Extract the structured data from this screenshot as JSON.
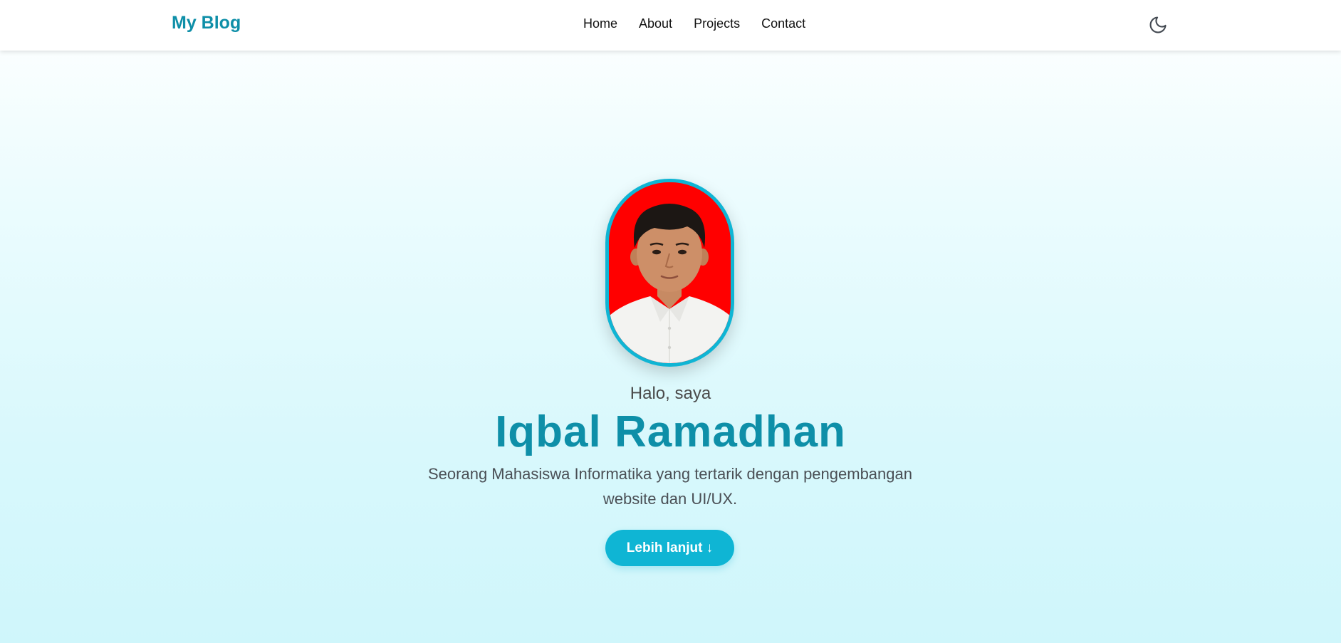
{
  "navbar": {
    "brand": "My Blog",
    "links": [
      {
        "label": "Home"
      },
      {
        "label": "About"
      },
      {
        "label": "Projects"
      },
      {
        "label": "Contact"
      }
    ],
    "theme_toggle_icon": "moon-icon"
  },
  "hero": {
    "greeting": "Halo, saya",
    "name": "Iqbal Ramadhan",
    "tagline": "Seorang Mahasiswa Informatika yang tertarik dengan pengembangan website dan UI/UX.",
    "cta_label": "Lebih lanjut ↓",
    "avatar_icon": "profile-photo"
  },
  "colors": {
    "accent": "#0e8fa8",
    "button": "#0fb5d4",
    "avatar_background": "#ff0000"
  }
}
